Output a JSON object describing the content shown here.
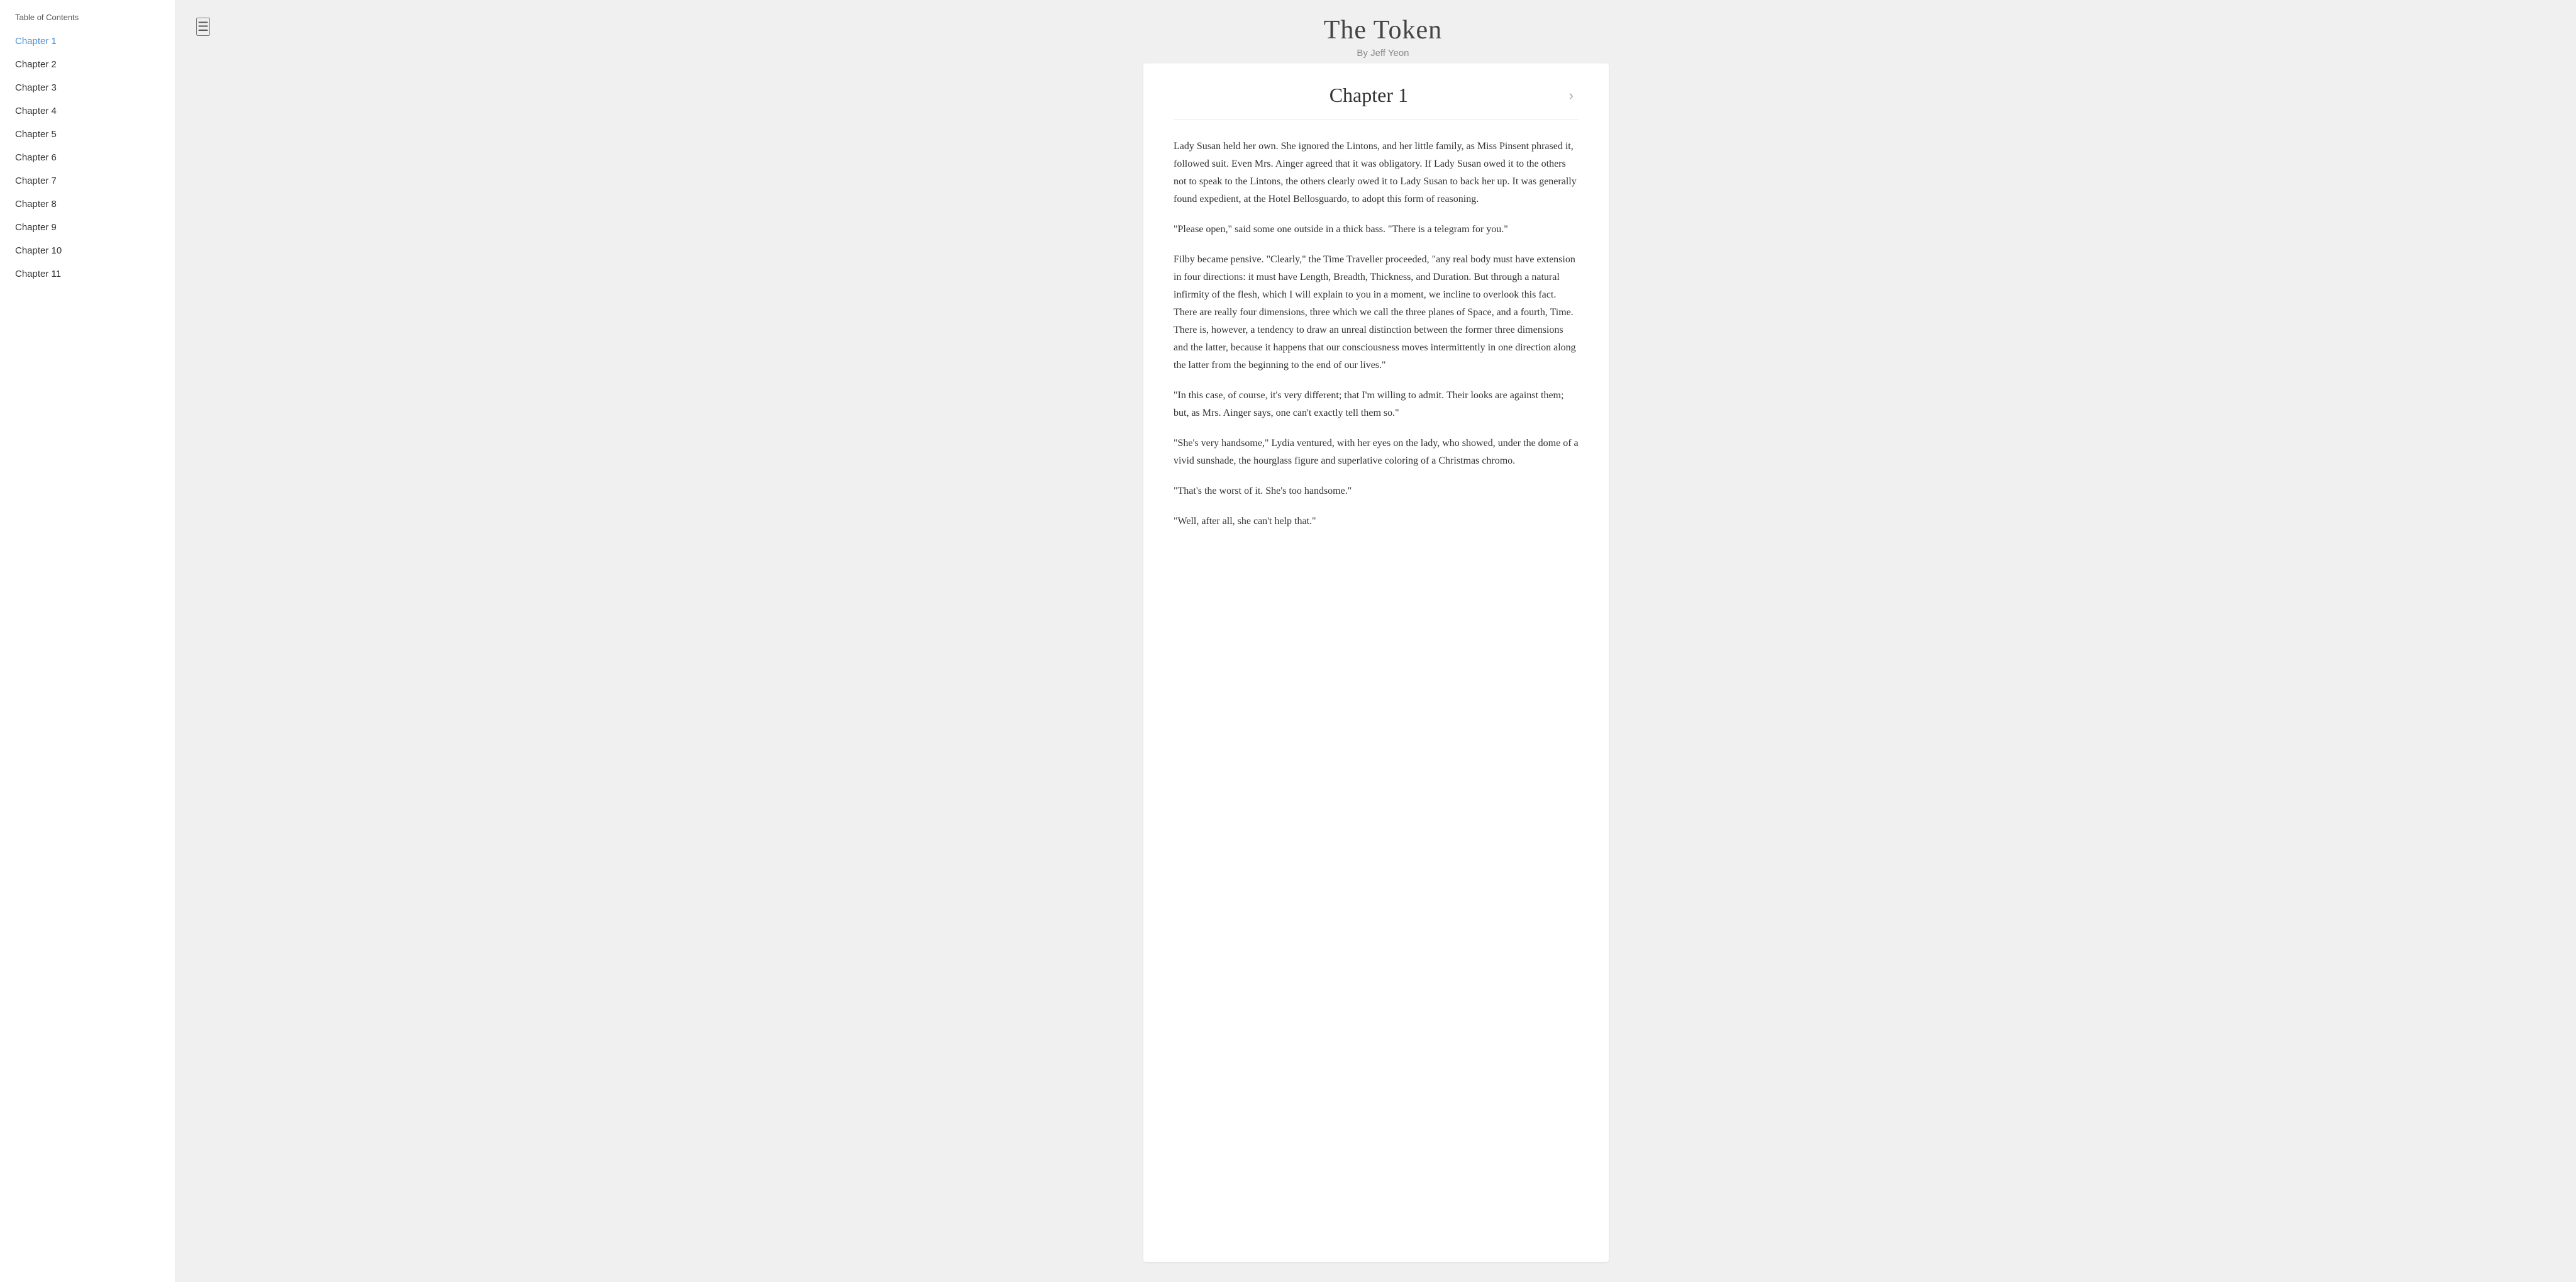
{
  "sidebar": {
    "toc_label": "Table of Contents",
    "chapters": [
      {
        "id": 1,
        "label": "Chapter 1",
        "active": true
      },
      {
        "id": 2,
        "label": "Chapter 2",
        "active": false
      },
      {
        "id": 3,
        "label": "Chapter 3",
        "active": false
      },
      {
        "id": 4,
        "label": "Chapter 4",
        "active": false
      },
      {
        "id": 5,
        "label": "Chapter 5",
        "active": false
      },
      {
        "id": 6,
        "label": "Chapter 6",
        "active": false
      },
      {
        "id": 7,
        "label": "Chapter 7",
        "active": false
      },
      {
        "id": 8,
        "label": "Chapter 8",
        "active": false
      },
      {
        "id": 9,
        "label": "Chapter 9",
        "active": false
      },
      {
        "id": 10,
        "label": "Chapter 10",
        "active": false
      },
      {
        "id": 11,
        "label": "Chapter 11",
        "active": false
      }
    ]
  },
  "header": {
    "book_title": "The Token",
    "book_author": "By Jeff Yeon",
    "menu_icon": "☰"
  },
  "chapter": {
    "title": "Chapter 1",
    "next_arrow": "›",
    "paragraphs": [
      "Lady Susan held her own. She ignored the Lintons, and her little family, as Miss Pinsent phrased it, followed suit. Even Mrs. Ainger agreed that it was obligatory. If Lady Susan owed it to the others not to speak to the Lintons, the others clearly owed it to Lady Susan to back her up. It was generally found expedient, at the Hotel Bellosguardo, to adopt this form of reasoning.",
      "\"Please open,\" said some one outside in a thick bass. \"There is a telegram for you.\"",
      "Filby became pensive. \"Clearly,\" the Time Traveller proceeded, \"any real body must have extension in four directions: it must have Length, Breadth, Thickness, and Duration. But through a natural infirmity of the flesh, which I will explain to you in a moment, we incline to overlook this fact. There are really four dimensions, three which we call the three planes of Space, and a fourth, Time. There is, however, a tendency to draw an unreal distinction between the former three dimensions and the latter, because it happens that our consciousness moves intermittently in one direction along the latter from the beginning to the end of our lives.\"",
      "\"In this case, of course, it's very different; that I'm willing to admit. Their looks are against them; but, as Mrs. Ainger says, one can't exactly tell them so.\"",
      "\"She's very handsome,\" Lydia ventured, with her eyes on the lady, who showed, under the dome of a vivid sunshade, the hourglass figure and superlative coloring of a Christmas chromo.",
      "\"That's the worst of it. She's too handsome.\"",
      "\"Well, after all, she can't help that.\""
    ]
  }
}
